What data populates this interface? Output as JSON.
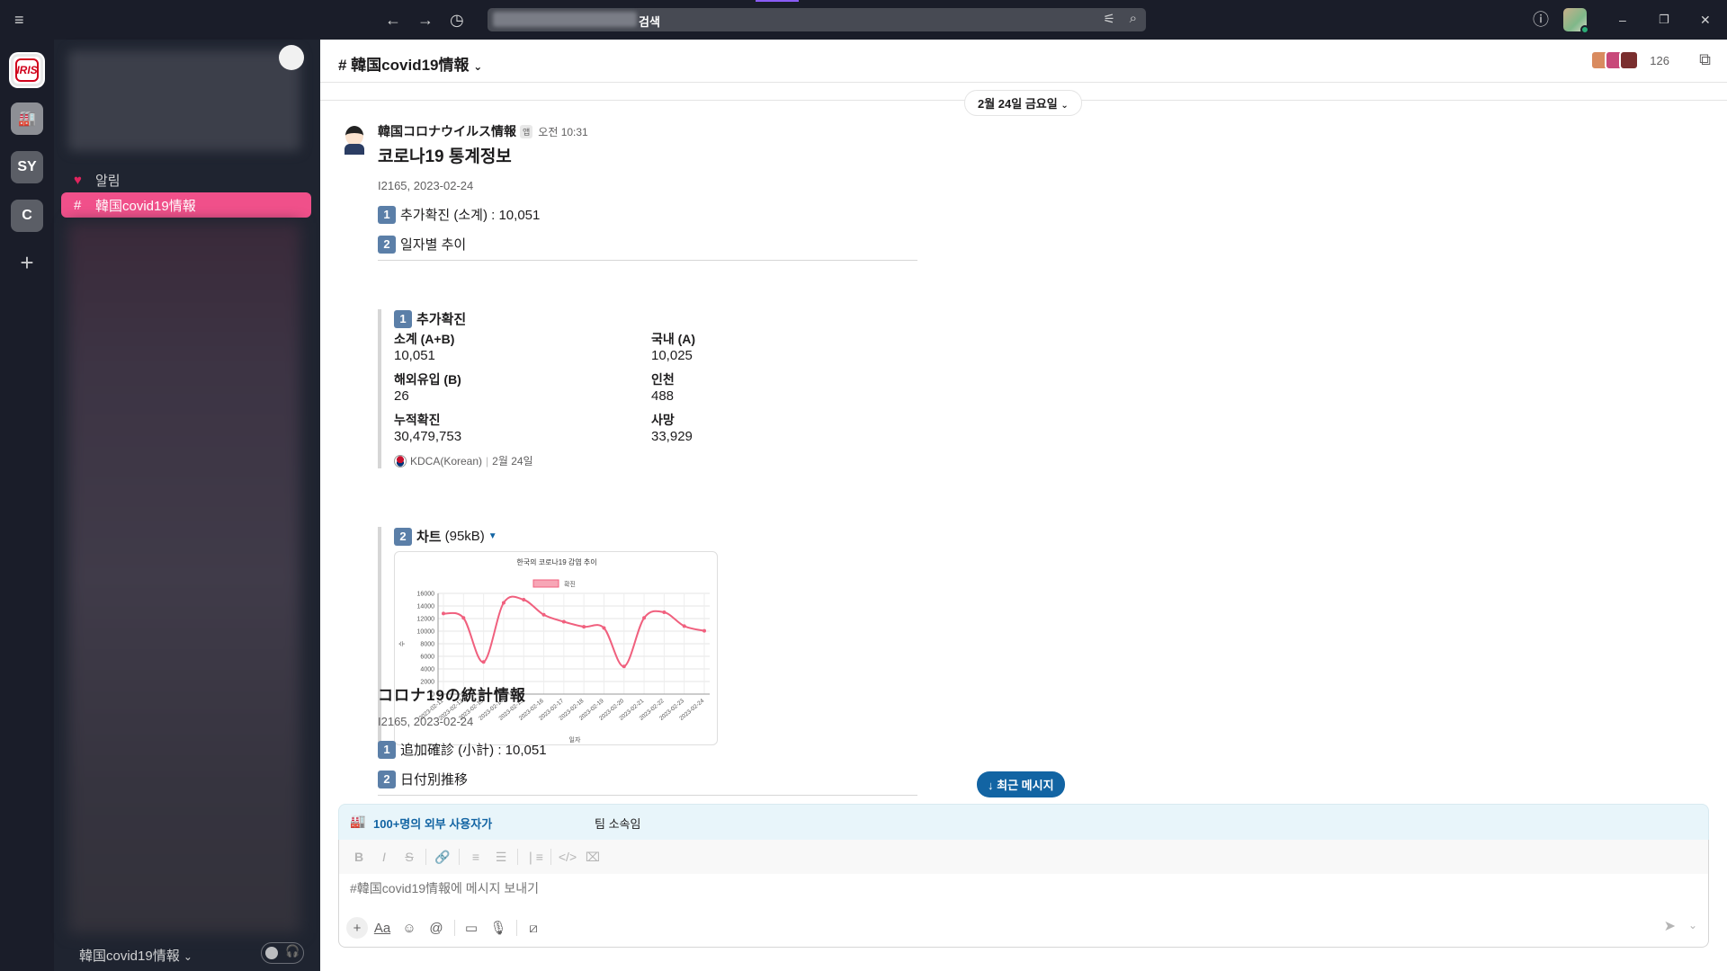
{
  "topbar": {
    "search_text": "검색",
    "menu_icon": "hamburger-icon",
    "back_icon": "arrow-left-icon",
    "forward_icon": "arrow-right-icon",
    "history_icon": "clock-icon",
    "filter_icon": "sliders-icon",
    "search_icon": "search-icon",
    "help_icon": "help-icon",
    "window": {
      "minimize": "–",
      "restore": "❐",
      "close": "✕"
    }
  },
  "rail": {
    "workspaces": [
      {
        "label": "IRIS"
      },
      {
        "label": "🏭"
      },
      {
        "label": "SY"
      },
      {
        "label": "C"
      }
    ],
    "add": "+"
  },
  "sidebar": {
    "alert_label": "알림",
    "active_channel": "韓国covid19情報",
    "footer_name": "韓国covid19情報",
    "footer_chevron": "⌄"
  },
  "channel": {
    "title": "# 韓国covid19情報",
    "member_count": "126",
    "date_divider": "2월 24일 금요일"
  },
  "message": {
    "sender": "韓国コロナウイルス情報",
    "app_badge": "앱",
    "time": "오전 10:31",
    "title_ko": "코로나19 통계정보",
    "meta_ko": "I2165, 2023-02-24",
    "item1_ko": "추가확진 (소계) : 10,051",
    "item2_ko": "일자별 추이",
    "attachment": {
      "title": "추가확진",
      "fields": [
        {
          "label": "소계 (A+B)",
          "value": "10,051"
        },
        {
          "label": "국내 (A)",
          "value": "10,025"
        },
        {
          "label": "해외유입 (B)",
          "value": "26"
        },
        {
          "label": "인천",
          "value": "488"
        },
        {
          "label": "누적확진",
          "value": "30,479,753"
        },
        {
          "label": "사망",
          "value": "33,929"
        }
      ],
      "source": "KDCA(Korean)",
      "source_date": "2월 24일"
    },
    "chart_attachment_title": "차트",
    "chart_attachment_size": "(95kB)",
    "title_ja": "コロナ19の統計情報",
    "meta_ja": "I2165, 2023-02-24",
    "item1_ja": "追加確診 (小計) : 10,051",
    "item2_ja": "日付別推移"
  },
  "chart_data": {
    "type": "line",
    "title": "한국의 코로나19 감염 추이",
    "legend": [
      "확진"
    ],
    "legend_position": "top",
    "xlabel": "일자",
    "ylabel": "수",
    "ylim": [
      0,
      16000
    ],
    "yticks": [
      0,
      2000,
      4000,
      6000,
      8000,
      10000,
      12000,
      14000,
      16000
    ],
    "grid": true,
    "color": "#f0607e",
    "categories": [
      "2023-02-11",
      "2023-02-12",
      "2023-02-13",
      "2023-02-14",
      "2023-02-15",
      "2023-02-16",
      "2023-02-17",
      "2023-02-18",
      "2023-02-19",
      "2023-02-20",
      "2023-02-21",
      "2023-02-22",
      "2023-02-23",
      "2023-02-24"
    ],
    "series": [
      {
        "name": "확진",
        "values": [
          12800,
          12100,
          5100,
          14500,
          15000,
          12600,
          11500,
          10700,
          10500,
          4400,
          12100,
          13000,
          10800,
          10051
        ]
      }
    ]
  },
  "jump_button": "↓ 최근 메시지",
  "composer": {
    "banner_link": "100+명의 외부 사용자가",
    "banner_text": "팀 소속임",
    "placeholder": "#韓国covid19情報에 메시지 보내기",
    "format_buttons": [
      "B",
      "I",
      "S",
      "🔗",
      "≡",
      "☰",
      "❘≡",
      "</>",
      "⌧"
    ]
  }
}
